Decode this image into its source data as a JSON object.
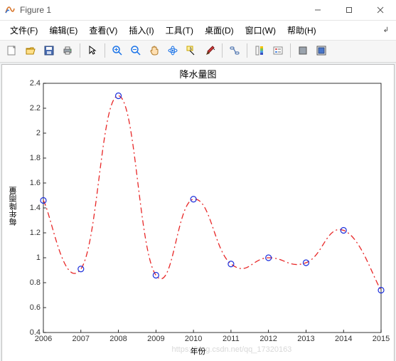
{
  "window": {
    "title": "Figure 1"
  },
  "menubar": {
    "items": [
      {
        "label": "文件(F)"
      },
      {
        "label": "编辑(E)"
      },
      {
        "label": "查看(V)"
      },
      {
        "label": "插入(I)"
      },
      {
        "label": "工具(T)"
      },
      {
        "label": "桌面(D)"
      },
      {
        "label": "窗口(W)"
      },
      {
        "label": "帮助(H)"
      }
    ]
  },
  "toolbar": {
    "groups": [
      [
        "new-figure-icon",
        "open-icon",
        "save-icon",
        "print-icon"
      ],
      [
        "pointer-icon"
      ],
      [
        "zoom-in-icon",
        "zoom-out-icon",
        "pan-icon",
        "rotate3d-icon",
        "data-cursor-icon",
        "brush-icon"
      ],
      [
        "link-icon"
      ],
      [
        "colorbar-icon",
        "legend-icon"
      ],
      [
        "hide-plot-tools-icon",
        "show-plot-tools-icon"
      ]
    ]
  },
  "chart_data": {
    "type": "line",
    "title": "降水量图",
    "xlabel": "年份",
    "ylabel": "每年降雨量",
    "x": [
      2006,
      2007,
      2008,
      2009,
      2010,
      2011,
      2012,
      2013,
      2014,
      2015
    ],
    "values": [
      1.46,
      0.91,
      2.3,
      0.86,
      1.47,
      0.95,
      1.0,
      0.96,
      1.22,
      0.74
    ],
    "xlim": [
      2006,
      2015
    ],
    "ylim": [
      0.4,
      2.4
    ],
    "xticks": [
      2006,
      2007,
      2008,
      2009,
      2010,
      2011,
      2012,
      2013,
      2014,
      2015
    ],
    "yticks": [
      0.4,
      0.6,
      0.8,
      1.0,
      1.2,
      1.4,
      1.6,
      1.8,
      2.0,
      2.2,
      2.4
    ],
    "ytick_labels": [
      "0.4",
      "0.6",
      "0.8",
      "1",
      "1.2",
      "1.4",
      "1.6",
      "1.8",
      "2",
      "2.2",
      "2.4"
    ],
    "line_style": "dash-dot",
    "line_color": "#e82727",
    "marker": "circle",
    "marker_edge": "#1b2fdc"
  },
  "watermark": {
    "text": "https://blog.csdn.net/qq_17320163"
  }
}
